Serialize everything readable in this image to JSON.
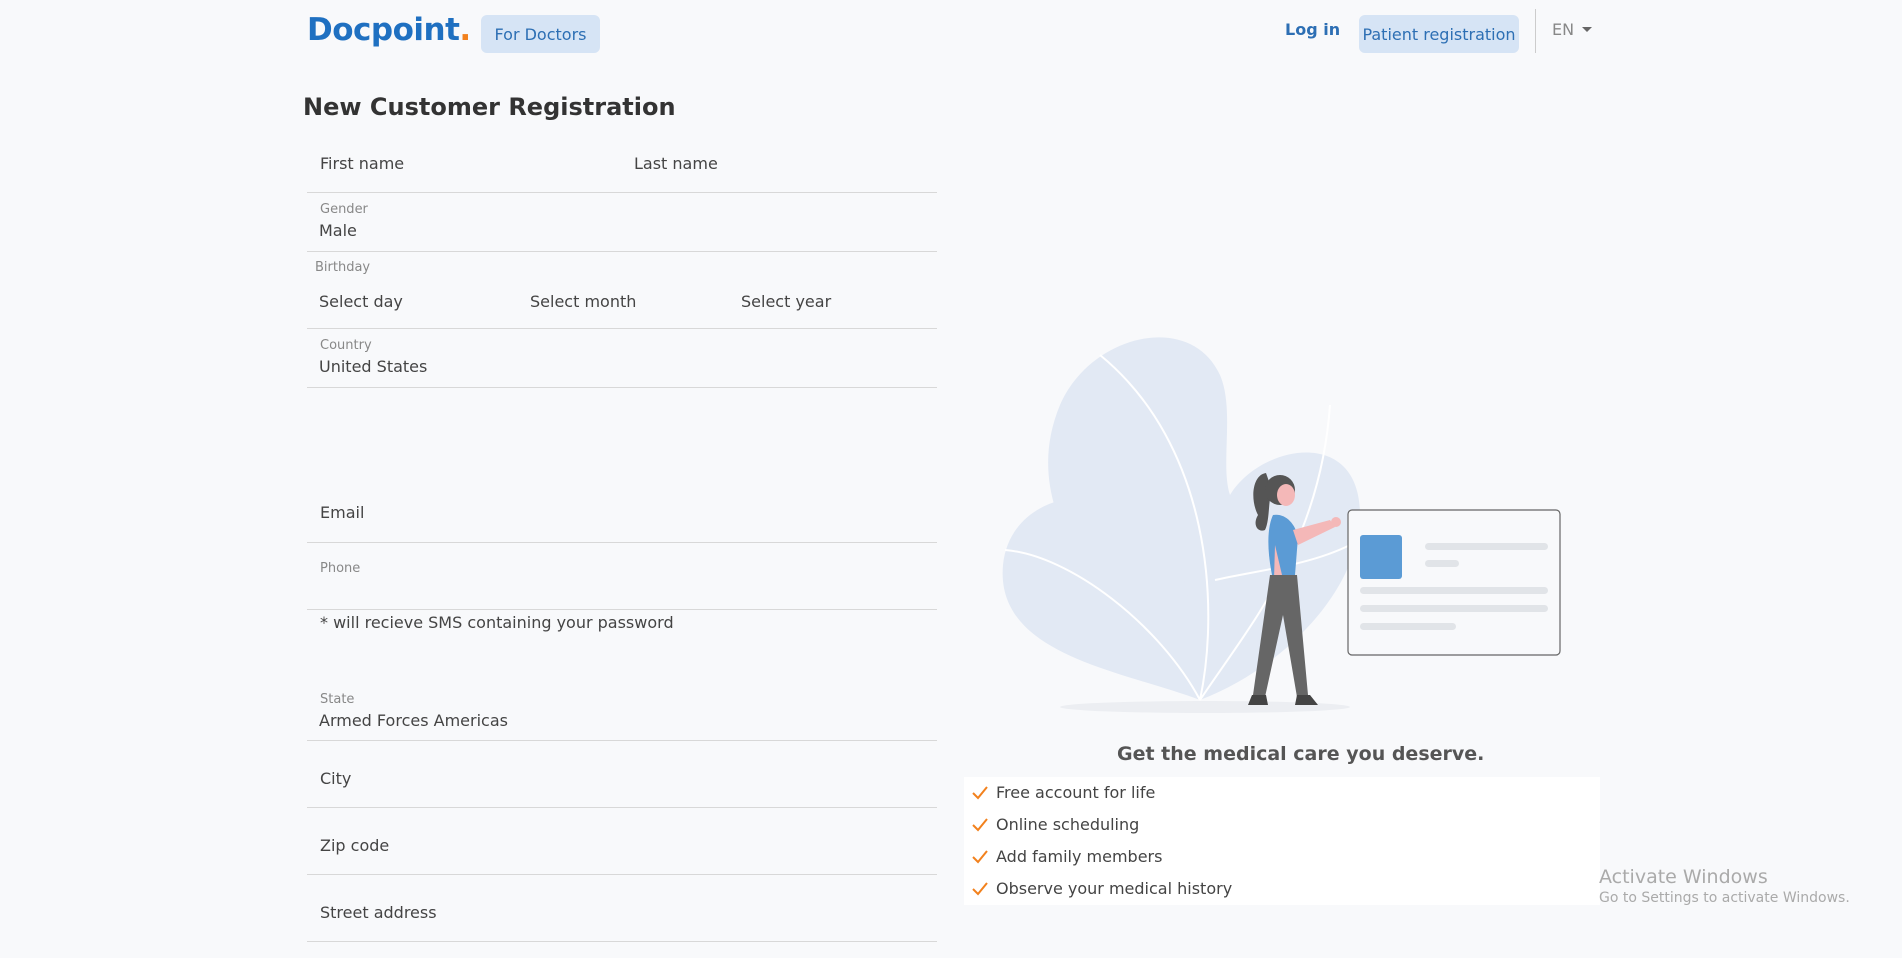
{
  "header": {
    "logo_text": "Docpoint",
    "logo_dot": ".",
    "for_doctors": "For Doctors",
    "login": "Log in",
    "patient_registration": "Patient registration",
    "language": "EN"
  },
  "form": {
    "title": "New Customer Registration",
    "first_name_placeholder": "First name",
    "last_name_placeholder": "Last name",
    "gender_label": "Gender",
    "gender_value": "Male",
    "birthday_label": "Birthday",
    "day_placeholder": "Select day",
    "month_placeholder": "Select month",
    "year_placeholder": "Select year",
    "country_label": "Country",
    "country_value": "United States",
    "email_placeholder": "Email",
    "phone_label": "Phone",
    "sms_note": "* will recieve SMS containing your password",
    "state_label": "State",
    "state_value": "Armed Forces Americas",
    "city_placeholder": "City",
    "zip_placeholder": "Zip code",
    "street_placeholder": "Street address"
  },
  "promo": {
    "tagline": "Get the medical care you deserve.",
    "benefits": [
      "Free account for life",
      "Online scheduling",
      "Add family members",
      "Observe your medical history"
    ]
  },
  "watermark": {
    "title": "Activate Windows",
    "subtitle": "Go to Settings to activate Windows."
  },
  "colors": {
    "brand_blue": "#1f70c1",
    "brand_orange": "#f2811d",
    "button_bg": "#d6e4f5",
    "check": "#f2811d"
  }
}
